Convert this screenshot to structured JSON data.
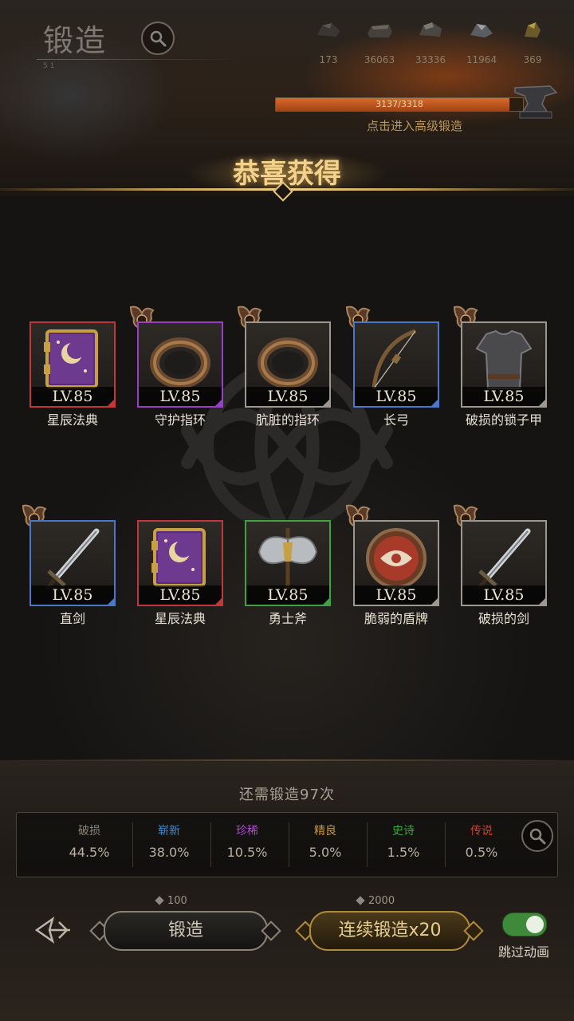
{
  "header": {
    "title": "锻造",
    "subtitle": "5 1"
  },
  "resources": [
    {
      "icon": "coal-icon",
      "value": "173"
    },
    {
      "icon": "iron-ore-icon",
      "value": "36063"
    },
    {
      "icon": "steel-ingot-icon",
      "value": "33336"
    },
    {
      "icon": "mithril-icon",
      "value": "11964"
    },
    {
      "icon": "gold-ore-icon",
      "value": "369"
    }
  ],
  "forge_progress": {
    "text": "3137/3318",
    "fraction": 0.945,
    "hint": "点击进入高级锻造"
  },
  "banner": {
    "title": "恭喜获得"
  },
  "items": [
    {
      "name": "星辰法典",
      "level": "LV.85",
      "rarity_color": "#c0383a",
      "icon": "tome-icon",
      "badge": false
    },
    {
      "name": "守护指环",
      "level": "LV.85",
      "rarity_color": "#9a3ec8",
      "icon": "ring-icon",
      "badge": true
    },
    {
      "name": "肮脏的指环",
      "level": "LV.85",
      "rarity_color": "#9c9890",
      "icon": "ring-icon",
      "badge": true
    },
    {
      "name": "长弓",
      "level": "LV.85",
      "rarity_color": "#4a78c8",
      "icon": "bow-icon",
      "badge": true
    },
    {
      "name": "破损的锁子甲",
      "level": "LV.85",
      "rarity_color": "#9c9890",
      "icon": "chainmail-icon",
      "badge": true
    },
    {
      "name": "直剑",
      "level": "LV.85",
      "rarity_color": "#4a78c8",
      "icon": "sword-icon",
      "badge": true
    },
    {
      "name": "星辰法典",
      "level": "LV.85",
      "rarity_color": "#c0383a",
      "icon": "tome-icon",
      "badge": false
    },
    {
      "name": "勇士斧",
      "level": "LV.85",
      "rarity_color": "#3ea23e",
      "icon": "axe-icon",
      "badge": false
    },
    {
      "name": "脆弱的盾牌",
      "level": "LV.85",
      "rarity_color": "#9c9890",
      "icon": "shield-icon",
      "badge": true
    },
    {
      "name": "破损的剑",
      "level": "LV.85",
      "rarity_color": "#9c9890",
      "icon": "sword-icon",
      "badge": true
    }
  ],
  "summary": {
    "title": "还需锻造97次",
    "stats": [
      {
        "label": "破损",
        "value": "44.5%",
        "color": "#8a8478"
      },
      {
        "label": "崭新",
        "value": "38.0%",
        "color": "#3c8ad0"
      },
      {
        "label": "珍稀",
        "value": "10.5%",
        "color": "#b04ad6"
      },
      {
        "label": "精良",
        "value": "5.0%",
        "color": "#c89a38"
      },
      {
        "label": "史诗",
        "value": "1.5%",
        "color": "#3aa83a"
      },
      {
        "label": "传说",
        "value": "0.5%",
        "color": "#d0402e"
      }
    ]
  },
  "actions": {
    "forge_cost": "100",
    "forge_label": "锻造",
    "multi_cost": "2000",
    "multi_label": "连续锻造x20",
    "skip_label": "跳过动画",
    "skip_on": true
  }
}
